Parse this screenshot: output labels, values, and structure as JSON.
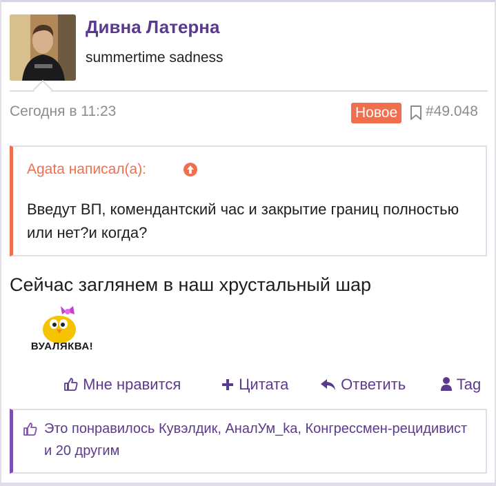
{
  "post": {
    "username": "Дивна Латерна",
    "user_title": "summertime sadness",
    "date": "Сегодня в 11:23",
    "badge": "Новое",
    "post_number": "#49.048",
    "quote": {
      "author": "Agata написал(а):",
      "text": "Введут ВП, комендантский час и закрытие границ полностью или нет?и когда?"
    },
    "message": "Сейчас заглянем в наш хрустальный шар",
    "sticker_text": "ВУАЛЯКВА!",
    "actions": {
      "like": "Мне нравится",
      "quote": "Цитата",
      "reply": "Ответить",
      "tag": "Tag"
    },
    "likes_text": "Это понравилось Кувэлдик, АналУм_ka, Конгрессмен-рецидивист и 20 другим"
  },
  "colors": {
    "username": "#5b3a8e",
    "accent_orange": "#ef6f4f",
    "accent_purple": "#7d4fb2",
    "muted": "#8c8c8c"
  },
  "icons": [
    "bookmark-icon",
    "arrow-up-circle-icon",
    "thumbs-up-icon",
    "plus-icon",
    "reply-icon",
    "user-icon"
  ]
}
